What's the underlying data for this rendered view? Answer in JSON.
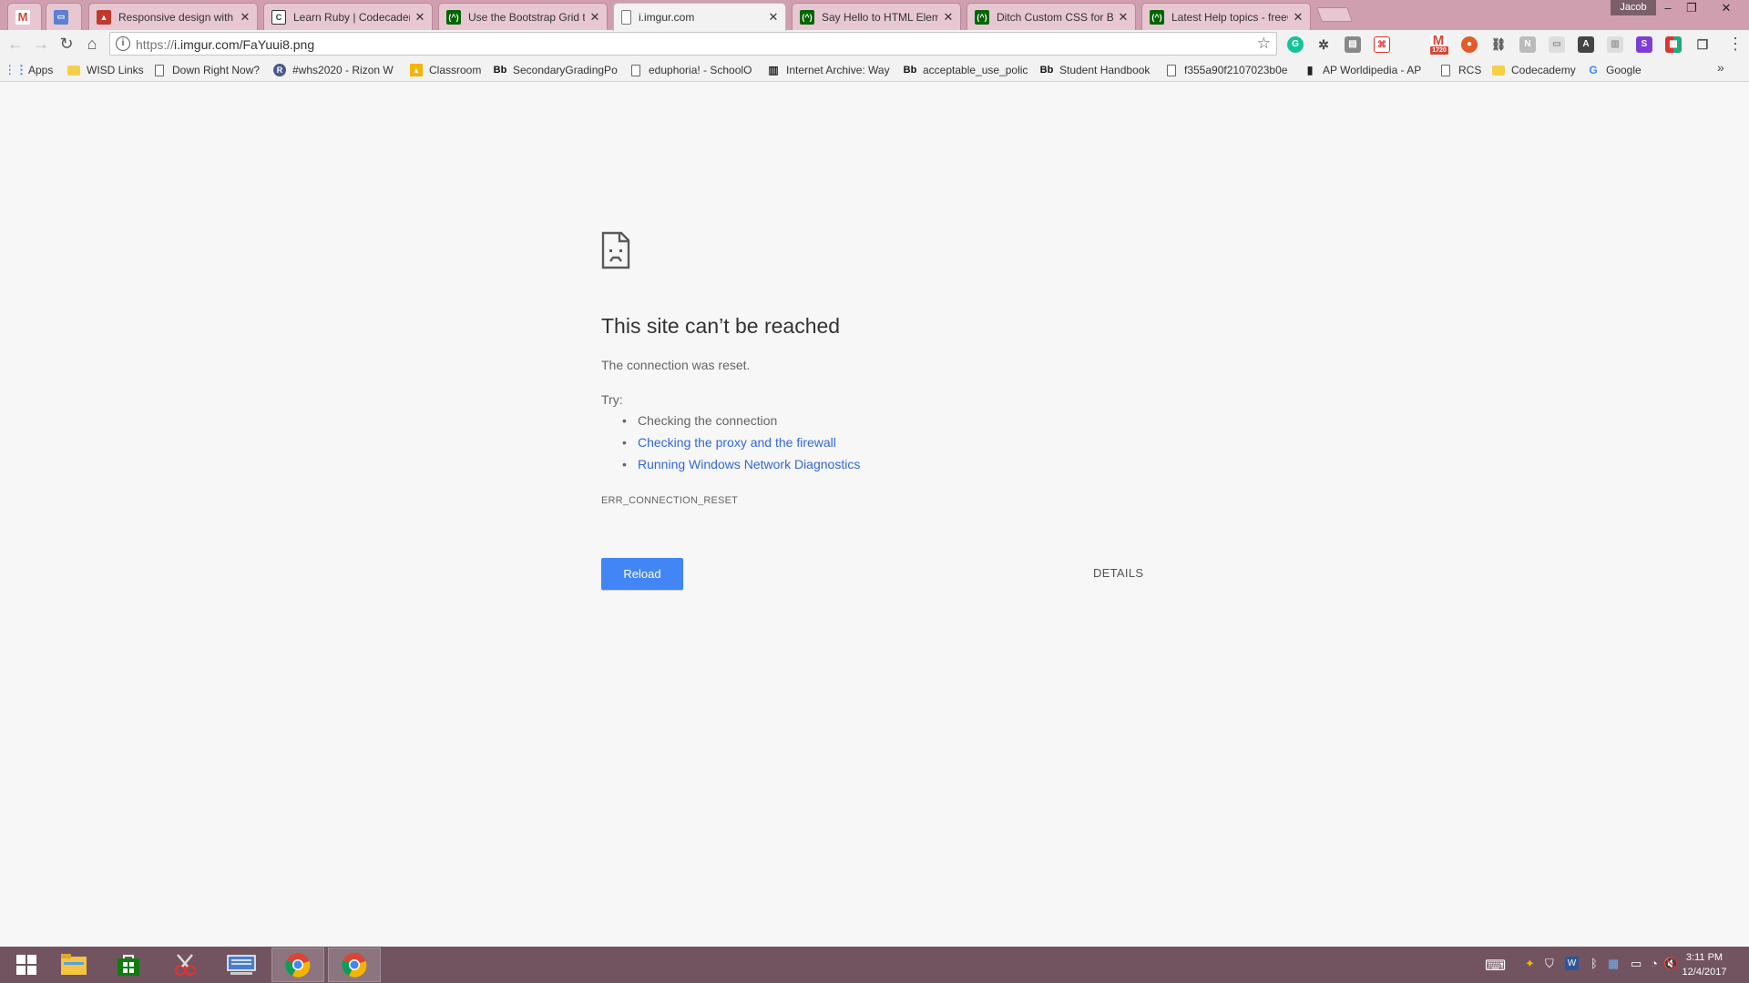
{
  "window": {
    "profile_name": "Jacob",
    "minimize_glyph": "–",
    "restore_glyph": "❐",
    "close_glyph": "✕"
  },
  "tabs": [
    {
      "title": "",
      "icon": "gmail-icon",
      "color": "#d44638",
      "active": false
    },
    {
      "title": "",
      "icon": "chat-icon",
      "color": "#5b7fd1",
      "active": false
    },
    {
      "title": "Responsive design with E",
      "icon": "page-icon",
      "color": "#c0392b",
      "active": false
    },
    {
      "title": "Learn Ruby | Codecadem",
      "icon": "codecademy-icon",
      "color": "#4a4a4a",
      "active": false
    },
    {
      "title": "Use the Bootstrap Grid t",
      "icon": "freecodecamp-icon",
      "color": "#006400",
      "active": false
    },
    {
      "title": "i.imgur.com",
      "icon": "page-icon",
      "color": "#ffffff",
      "active": true
    },
    {
      "title": "Say Hello to HTML Eleme",
      "icon": "freecodecamp-icon",
      "color": "#006400",
      "active": false
    },
    {
      "title": "Ditch Custom CSS for Bo",
      "icon": "freecodecamp-icon",
      "color": "#006400",
      "active": false
    },
    {
      "title": "Latest Help topics - freeC",
      "icon": "freecodecamp-icon",
      "color": "#006400",
      "active": false
    }
  ],
  "toolbar": {
    "back_glyph": "←",
    "forward_glyph": "→",
    "reload_glyph": "↻",
    "home_glyph": "⌂",
    "url_scheme": "https://",
    "url_rest": "i.imgur.com/FaYuui8.png",
    "info_glyph": "i",
    "star_glyph": "☆",
    "menu_glyph": "⋮",
    "gmail_badge": "1720"
  },
  "bookmarks": [
    {
      "label": "Apps",
      "icon": "apps-grid-icon"
    },
    {
      "label": "WISD Links",
      "icon": "folder-icon"
    },
    {
      "label": "Down Right Now?",
      "icon": "page-icon"
    },
    {
      "label": "#whs2020 - Rizon W",
      "icon": "rizon-icon"
    },
    {
      "label": "Classroom",
      "icon": "classroom-icon"
    },
    {
      "label": "SecondaryGradingPo",
      "icon": "blackboard-icon"
    },
    {
      "label": "eduphoria! - SchoolO",
      "icon": "page-icon"
    },
    {
      "label": "Internet Archive: Way",
      "icon": "archive-icon"
    },
    {
      "label": "acceptable_use_polic",
      "icon": "blackboard-icon"
    },
    {
      "label": "Student Handbook",
      "icon": "blackboard-icon"
    },
    {
      "label": "f355a90f2107023b0e",
      "icon": "page-icon"
    },
    {
      "label": "AP Worldipedia - AP",
      "icon": "worldipedia-icon"
    },
    {
      "label": "RCS",
      "icon": "page-icon"
    },
    {
      "label": "Codecademy",
      "icon": "folder-icon"
    },
    {
      "label": "Google",
      "icon": "google-icon"
    }
  ],
  "bookmarks_more_glyph": "»",
  "error": {
    "title": "This site can’t be reached",
    "subtitle": "The connection was reset.",
    "try_label": "Try:",
    "suggestions": [
      {
        "text": "Checking the connection",
        "link": false
      },
      {
        "text": "Checking the proxy and the firewall",
        "link": true
      },
      {
        "text": "Running Windows Network Diagnostics",
        "link": true
      }
    ],
    "code": "ERR_CONNECTION_RESET",
    "reload_label": "Reload",
    "details_label": "DETAILS"
  },
  "taskbar": {
    "items": [
      "start-icon",
      "file-explorer-icon",
      "store-icon",
      "snipping-tool-icon",
      "keyboard-app-icon",
      "chrome-icon",
      "chrome-icon"
    ],
    "clock_time": "3:11 PM",
    "clock_date": "12/4/2017"
  },
  "colors": {
    "accent": "#4285f4",
    "link": "#3367d6",
    "tabstrip": "#cf9fb0",
    "taskbar": "#715460"
  }
}
